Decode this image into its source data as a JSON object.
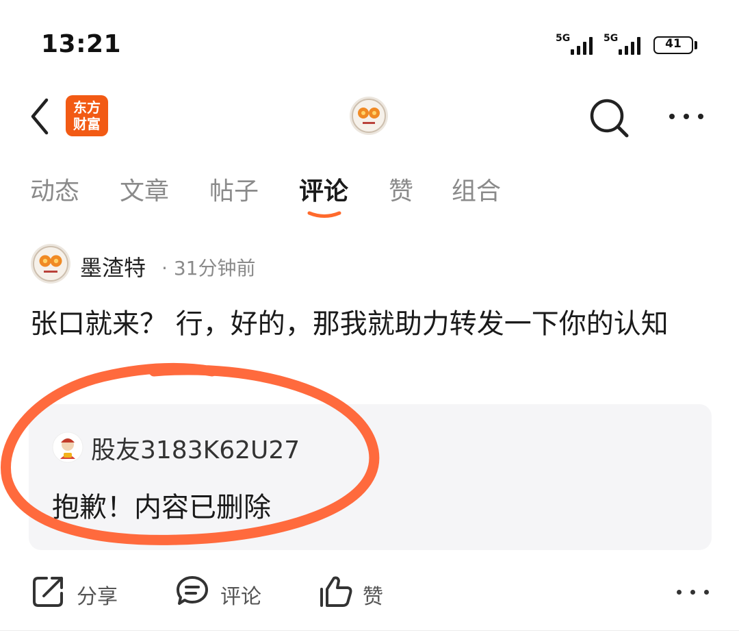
{
  "status_bar": {
    "time": "13:21",
    "network_1": "5G",
    "network_2": "5G",
    "battery": "41"
  },
  "header": {
    "brand_line1": "东方",
    "brand_line2": "财富",
    "brand_color": "#f25a14",
    "back_icon": "chevron-left-icon",
    "search_icon": "search-icon",
    "more_icon": "more-horizontal-icon"
  },
  "tabs": [
    {
      "label": "动态",
      "active": false
    },
    {
      "label": "文章",
      "active": false
    },
    {
      "label": "帖子",
      "active": false
    },
    {
      "label": "评论",
      "active": true
    },
    {
      "label": "赞",
      "active": false
    },
    {
      "label": "组合",
      "active": false
    }
  ],
  "post": {
    "author": "墨渣特",
    "separator": "·",
    "time": "31分钟前",
    "text": "张口就来？  行，好的，那我就助力转发一下你的认知"
  },
  "quoted": {
    "username": "股友3183K62U27",
    "text": "抱歉！内容已删除"
  },
  "actions": {
    "share": "分享",
    "comment": "评论",
    "like": "赞"
  },
  "accent_color": "#ff6a2c",
  "annotation_color": "#ff6a3d"
}
